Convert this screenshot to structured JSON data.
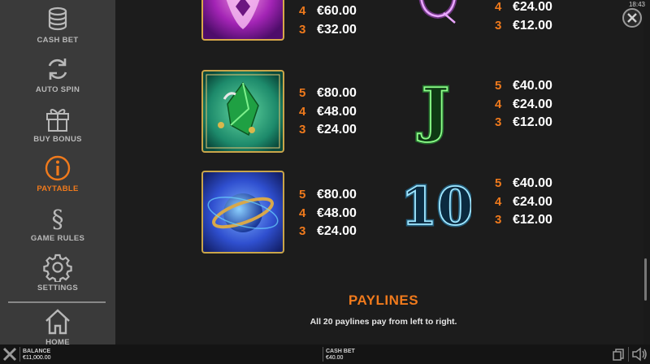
{
  "sidebar": {
    "items": [
      {
        "label": "CASH BET",
        "icon": "coins-icon"
      },
      {
        "label": "AUTO SPIN",
        "icon": "refresh-icon"
      },
      {
        "label": "BUY BONUS",
        "icon": "gift-icon"
      },
      {
        "label": "PAYTABLE",
        "icon": "info-icon"
      },
      {
        "label": "GAME RULES",
        "icon": "section-icon"
      },
      {
        "label": "SETTINGS",
        "icon": "gear-icon"
      },
      {
        "label": "HOME",
        "icon": "home-icon"
      }
    ],
    "active": "PAYTABLE"
  },
  "clock": "18:43",
  "paytable": {
    "rows": [
      {
        "left": {
          "symbol": "pink-flower-icon",
          "pays": [
            {
              "count": "4",
              "value": "€60.00"
            },
            {
              "count": "3",
              "value": "€32.00"
            }
          ]
        },
        "right": {
          "symbol": "letter-q-icon",
          "pays": [
            {
              "count": "4",
              "value": "€24.00"
            },
            {
              "count": "3",
              "value": "€12.00"
            }
          ]
        }
      },
      {
        "left": {
          "symbol": "green-gem-icon",
          "pays": [
            {
              "count": "5",
              "value": "€80.00"
            },
            {
              "count": "4",
              "value": "€48.00"
            },
            {
              "count": "3",
              "value": "€24.00"
            }
          ]
        },
        "right": {
          "symbol": "letter-j-icon",
          "glyph": "J",
          "pays": [
            {
              "count": "5",
              "value": "€40.00"
            },
            {
              "count": "4",
              "value": "€24.00"
            },
            {
              "count": "3",
              "value": "€12.00"
            }
          ]
        }
      },
      {
        "left": {
          "symbol": "blue-planet-icon",
          "pays": [
            {
              "count": "5",
              "value": "€80.00"
            },
            {
              "count": "4",
              "value": "€48.00"
            },
            {
              "count": "3",
              "value": "€24.00"
            }
          ]
        },
        "right": {
          "symbol": "number-10-icon",
          "glyph": "10",
          "pays": [
            {
              "count": "5",
              "value": "€40.00"
            },
            {
              "count": "4",
              "value": "€24.00"
            },
            {
              "count": "3",
              "value": "€12.00"
            }
          ]
        }
      }
    ]
  },
  "paylines": {
    "title": "PAYLINES",
    "description": "All 20 paylines pay from left to right."
  },
  "bottom_bar": {
    "balance_label": "BALANCE",
    "balance_value": "€11,000.00",
    "cash_bet_label": "CASH BET",
    "cash_bet_value": "€40.00"
  },
  "colors": {
    "accent": "#f07a1c",
    "sidebar_bg": "#3a3a3a",
    "main_bg": "#1c1c1c",
    "label": "#b8b8b8"
  }
}
